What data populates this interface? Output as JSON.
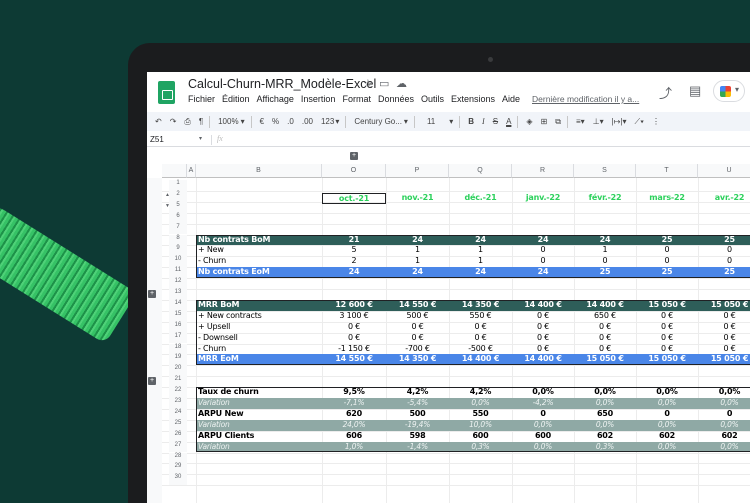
{
  "app": {
    "title": "Calcul-Churn-MRR_Modèle-Excel",
    "menu": [
      "Fichier",
      "Édition",
      "Affichage",
      "Insertion",
      "Format",
      "Données",
      "Outils",
      "Extensions",
      "Aide"
    ],
    "last_modified": "Dernière modification il y a..."
  },
  "toolbar": {
    "zoom": "100%",
    "currency": "€",
    "percent": "%",
    "dec_less": ".0",
    "dec_more": ".00",
    "number_format": "123",
    "font": "Century Go...",
    "font_size": "11",
    "bold": "B",
    "italic": "I",
    "strike": "S",
    "text_color": "A"
  },
  "formula_bar": {
    "cell_ref": "Z51",
    "fx": "fx"
  },
  "columns": [
    "A",
    "B",
    "O",
    "P",
    "Q",
    "R",
    "S",
    "T",
    "U"
  ],
  "row_numbers": [
    "1",
    "2",
    "5",
    "6",
    "7",
    "8",
    "9",
    "10",
    "11",
    "12",
    "13",
    "14",
    "15",
    "16",
    "17",
    "18",
    "19",
    "20",
    "21",
    "22",
    "23",
    "24",
    "25",
    "26",
    "27",
    "28",
    "29",
    "30"
  ],
  "months": [
    "oct.-21",
    "nov.-21",
    "déc.-21",
    "janv.-22",
    "févr.-22",
    "mars-22",
    "avr.-22"
  ],
  "rows": [
    {
      "label": "Nb contrats BoM",
      "style": "head",
      "values": [
        "21",
        "24",
        "24",
        "24",
        "24",
        "25",
        "25"
      ]
    },
    {
      "label": "+ New",
      "style": "plain",
      "values": [
        "5",
        "1",
        "1",
        "0",
        "1",
        "0",
        "0"
      ]
    },
    {
      "label": "- Churn",
      "style": "plain",
      "values": [
        "2",
        "1",
        "1",
        "0",
        "0",
        "0",
        "0"
      ]
    },
    {
      "label": "Nb contrats EoM",
      "style": "foot",
      "values": [
        "24",
        "24",
        "24",
        "24",
        "25",
        "25",
        "25"
      ]
    },
    {
      "label": "",
      "style": "blank",
      "values": []
    },
    {
      "label": "",
      "style": "blank",
      "values": []
    },
    {
      "label": "MRR BoM",
      "style": "head",
      "values": [
        "12 600 €",
        "14 550 €",
        "14 350 €",
        "14 400 €",
        "14 400 €",
        "15 050 €",
        "15 050 €"
      ]
    },
    {
      "label": "+ New contracts",
      "style": "plain",
      "values": [
        "3 100 €",
        "500 €",
        "550 €",
        "0 €",
        "650 €",
        "0 €",
        "0 €"
      ]
    },
    {
      "label": "+ Upsell",
      "style": "plain",
      "values": [
        "0 €",
        "0 €",
        "0 €",
        "0 €",
        "0 €",
        "0 €",
        "0 €"
      ]
    },
    {
      "label": "- Downsell",
      "style": "plain",
      "values": [
        "0 €",
        "0 €",
        "0 €",
        "0 €",
        "0 €",
        "0 €",
        "0 €"
      ]
    },
    {
      "label": "- Churn",
      "style": "plain",
      "values": [
        "-1 150 €",
        "-700 €",
        "-500 €",
        "0 €",
        "0 €",
        "0 €",
        "0 €"
      ]
    },
    {
      "label": "MRR EoM",
      "style": "foot",
      "values": [
        "14 550 €",
        "14 350 €",
        "14 400 €",
        "14 400 €",
        "15 050 €",
        "15 050 €",
        "15 050 €"
      ]
    },
    {
      "label": "",
      "style": "blank",
      "values": []
    },
    {
      "label": "",
      "style": "blank",
      "values": []
    },
    {
      "label": "Taux de churn",
      "style": "bold",
      "values": [
        "9,5%",
        "4,2%",
        "4,2%",
        "0,0%",
        "0,0%",
        "0,0%",
        "0,0%"
      ]
    },
    {
      "label": "Variation",
      "style": "var",
      "values": [
        "-7,1%",
        "-5,4%",
        "0,0%",
        "-4,2%",
        "0,0%",
        "0,0%",
        "0,0%"
      ]
    },
    {
      "label": "ARPU New",
      "style": "bold",
      "values": [
        "620",
        "500",
        "550",
        "0",
        "650",
        "0",
        "0"
      ]
    },
    {
      "label": "Variation",
      "style": "var",
      "values": [
        "24,0%",
        "-19,4%",
        "10,0%",
        "0,0%",
        "0,0%",
        "0,0%",
        "0,0%"
      ]
    },
    {
      "label": "ARPU Clients",
      "style": "bold",
      "values": [
        "606",
        "598",
        "600",
        "600",
        "602",
        "602",
        "602"
      ]
    },
    {
      "label": "Variation",
      "style": "var",
      "values": [
        "1,0%",
        "-1,4%",
        "0,3%",
        "0,0%",
        "0,3%",
        "0,0%",
        "0,0%"
      ]
    }
  ],
  "colors": {
    "header_row": "#2e5e59",
    "total_row": "#4a86e8",
    "variation_row": "#8fa9a5",
    "month_text": "#2cd15c",
    "background": "#0d3a34"
  }
}
